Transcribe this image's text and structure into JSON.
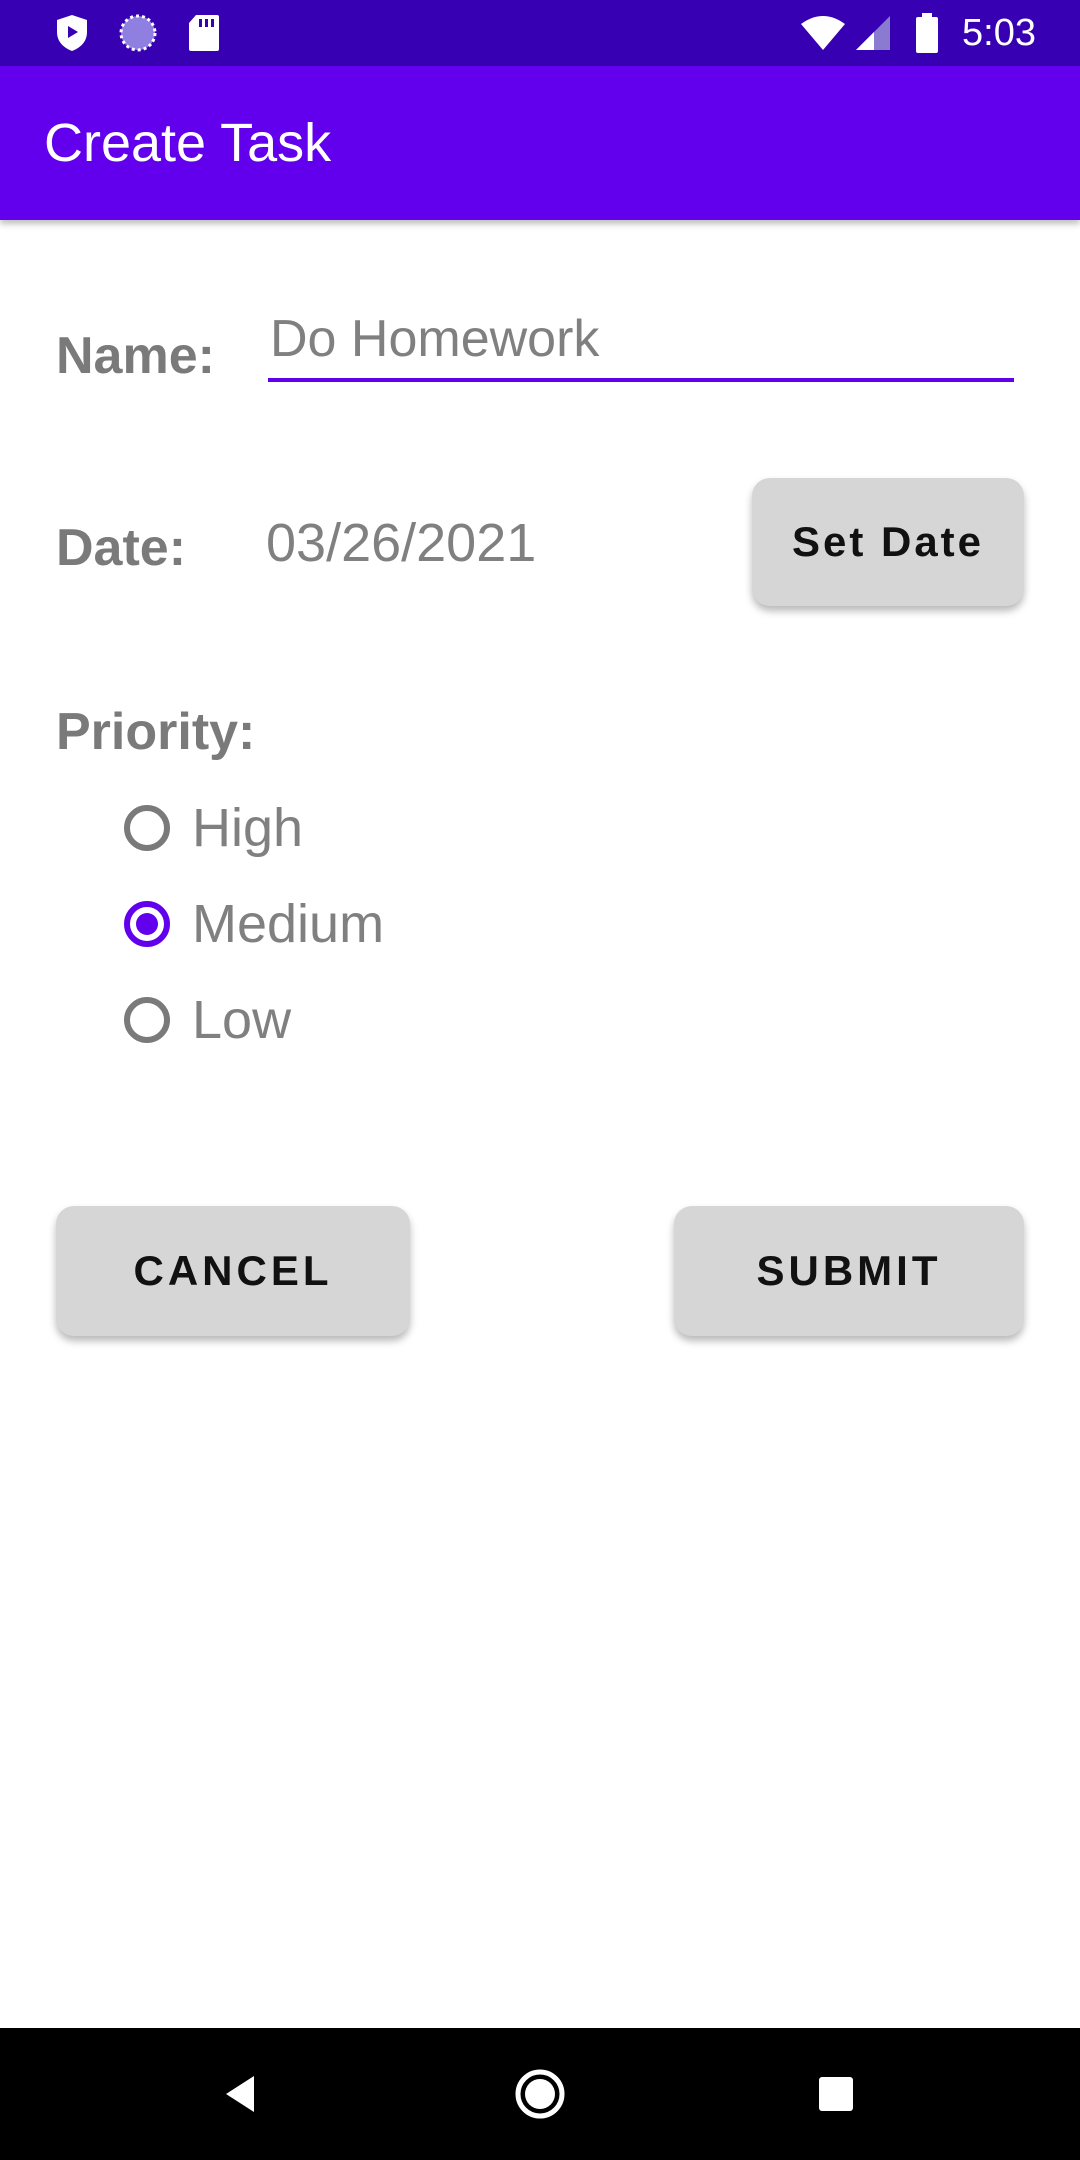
{
  "status_bar": {
    "time": "5:03",
    "icons": [
      "shield-icon",
      "sync-icon",
      "sd-card-icon",
      "wifi-icon",
      "signal-icon",
      "battery-icon"
    ]
  },
  "app_bar": {
    "title": "Create Task"
  },
  "form": {
    "name_label": "Name:",
    "name_value": "Do Homework",
    "date_label": "Date:",
    "date_value": "03/26/2021",
    "set_date_button": "Set Date",
    "priority_label": "Priority:",
    "priority_options": [
      {
        "label": "High",
        "checked": false
      },
      {
        "label": "Medium",
        "checked": true
      },
      {
        "label": "Low",
        "checked": false
      }
    ]
  },
  "actions": {
    "cancel": "CANCEL",
    "submit": "SUBMIT"
  },
  "colors": {
    "status_bar": "#3700B3",
    "primary": "#6200EE",
    "button_bg": "#D6D6D6",
    "label_gray": "#7A7A7A"
  },
  "nav_bar": {
    "icons": [
      "back-icon",
      "home-icon",
      "recents-icon"
    ]
  }
}
